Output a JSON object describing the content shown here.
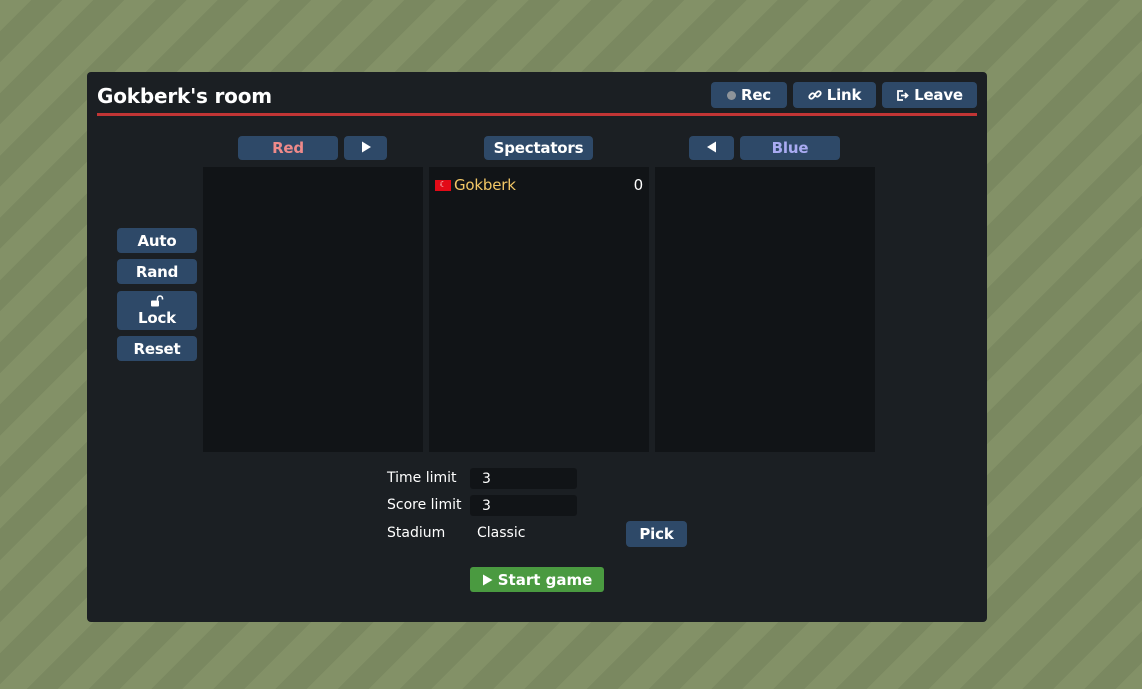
{
  "room": {
    "title": "Gokberk's room"
  },
  "header_buttons": {
    "rec": "Rec",
    "link": "Link",
    "leave": "Leave"
  },
  "teams": {
    "red": {
      "label": "Red",
      "players": []
    },
    "spectators": {
      "label": "Spectators",
      "players": [
        {
          "name": "Gokberk",
          "ping": "0",
          "flag": "TR"
        }
      ]
    },
    "blue": {
      "label": "Blue",
      "players": []
    }
  },
  "side_buttons": {
    "auto": "Auto",
    "rand": "Rand",
    "lock": "Lock",
    "reset": "Reset"
  },
  "settings": {
    "time_limit": {
      "label": "Time limit",
      "value": "3"
    },
    "score_limit": {
      "label": "Score limit",
      "value": "3"
    },
    "stadium": {
      "label": "Stadium",
      "value": "Classic"
    },
    "pick_label": "Pick"
  },
  "start_label": "Start game",
  "colors": {
    "red_line": "#c13535",
    "button": "#2e4968",
    "start": "#4a9a40",
    "player_name": "#f2c766"
  },
  "icons": {
    "rec": "record-dot-icon",
    "link": "link-icon",
    "leave": "leave-icon",
    "move_right": "triangle-right-icon",
    "move_left": "triangle-left-icon",
    "lock": "unlock-icon",
    "play": "play-icon"
  }
}
